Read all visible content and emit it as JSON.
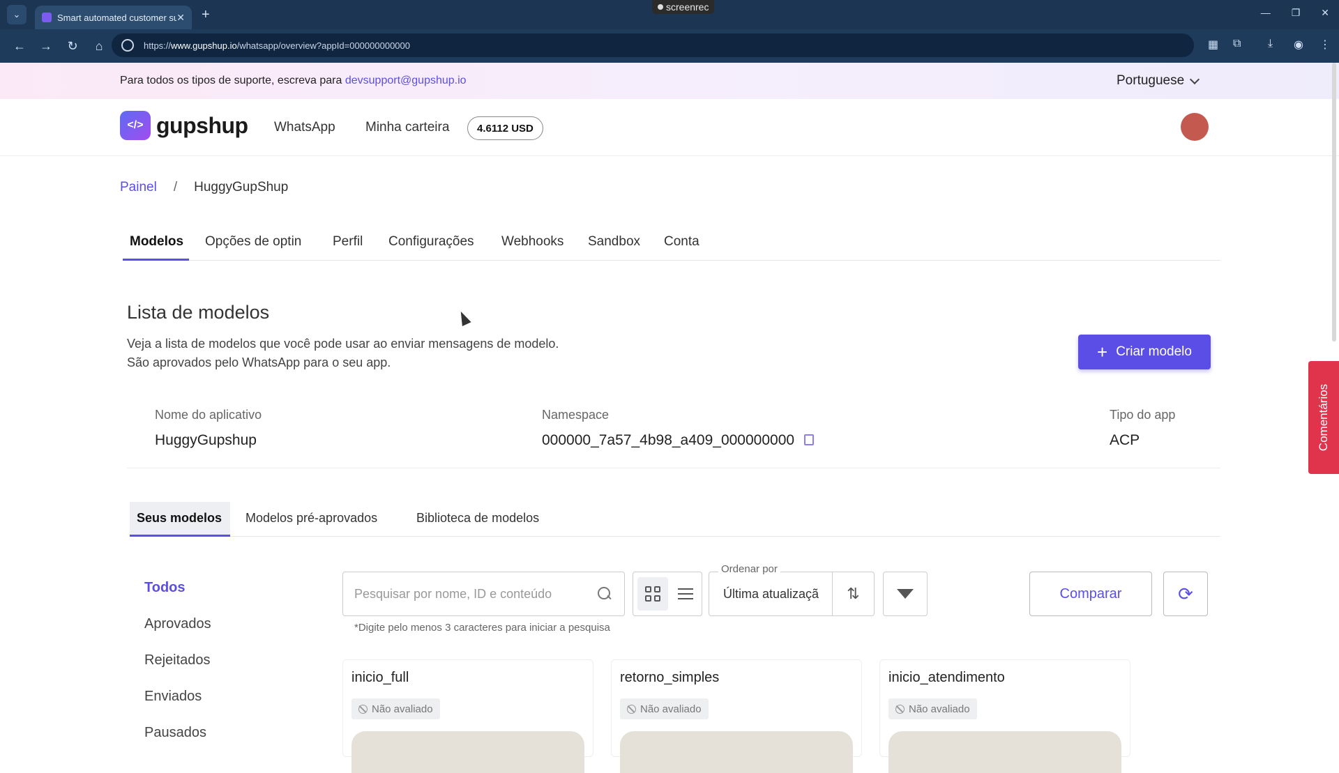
{
  "browser": {
    "tab_title": "Smart automated customer su",
    "url_prefix": "https://",
    "url_host": "www.gupshup.io",
    "url_path": "/whatsapp/overview?appId=000000000000",
    "recorder": "screenrec"
  },
  "support": {
    "text": "Para todos os tipos de suporte, escreva para",
    "email": "devsupport@gupshup.io",
    "language": "Portuguese"
  },
  "header": {
    "logo_text": "gupshup",
    "nav_whatsapp": "WhatsApp",
    "nav_wallet": "Minha carteira",
    "balance": "4.6112 USD"
  },
  "breadcrumb": {
    "root": "Painel",
    "separator": "/",
    "current": "HuggyGupShup"
  },
  "tabs": [
    "Modelos",
    "Opções de optin",
    "Perfil",
    "Configurações",
    "Webhooks",
    "Sandbox",
    "Conta"
  ],
  "main": {
    "title": "Lista de modelos",
    "desc_line1": "Veja a lista de modelos que você pode usar ao enviar mensagens de modelo.",
    "desc_line2": "São aprovados pelo WhatsApp para o seu app.",
    "create_label": "Criar modelo"
  },
  "app_info": {
    "name_label": "Nome do aplicativo",
    "name_value": "HuggyGupshup",
    "namespace_label": "Namespace",
    "namespace_value": "000000_7a57_4b98_a409_000000000",
    "type_label": "Tipo do app",
    "type_value": "ACP"
  },
  "subtabs": [
    "Seus modelos",
    "Modelos pré-aprovados",
    "Biblioteca de modelos"
  ],
  "filters": [
    "Todos",
    "Aprovados",
    "Rejeitados",
    "Enviados",
    "Pausados"
  ],
  "toolbar": {
    "search_placeholder": "Pesquisar por nome, ID e conteúdo",
    "order_label": "Ordenar por",
    "order_value": "Última atualizaçã",
    "compare_label": "Comparar",
    "hint": "*Digite pelo menos 3 caracteres para iniciar a pesquisa"
  },
  "cards": [
    {
      "name": "inicio_full",
      "status": "Não avaliado"
    },
    {
      "name": "retorno_simples",
      "status": "Não avaliado"
    },
    {
      "name": "inicio_atendimento",
      "status": "Não avaliado"
    }
  ],
  "feedback_label": "Comentários",
  "colors": {
    "accent": "#5b4ee6",
    "feedback": "#e0344d",
    "avatar": "#c3594f"
  }
}
